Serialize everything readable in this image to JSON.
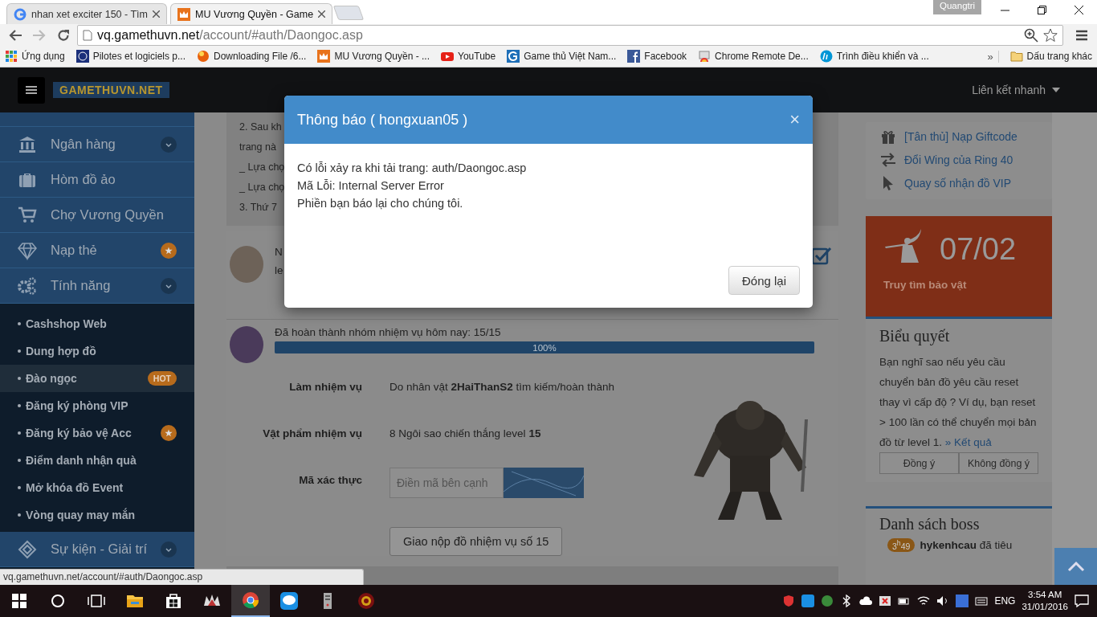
{
  "browser": {
    "tabs": [
      {
        "title": "nhan xet exciter 150 - Tìm",
        "kind": "google",
        "selected": false
      },
      {
        "title": "MU Vương Quyền - Game",
        "kind": "crown",
        "selected": true
      }
    ],
    "profile": "Quangtri",
    "address": {
      "host": "vq.gamethuvn.net",
      "path": "/account/#auth/Daongoc.asp"
    },
    "bookmarks": [
      {
        "label": "Ứng dụng",
        "kind": "apps"
      },
      {
        "label": "Pilotes et logiciels p...",
        "kind": "hp"
      },
      {
        "label": "Downloading File /6...",
        "kind": "ball"
      },
      {
        "label": "MU Vương Quyền - ...",
        "kind": "crown"
      },
      {
        "label": "YouTube",
        "kind": "youtube"
      },
      {
        "label": "Game thủ Việt Nam...",
        "kind": "g"
      },
      {
        "label": "Facebook",
        "kind": "facebook"
      },
      {
        "label": "Chrome Remote De...",
        "kind": "remote"
      },
      {
        "label": "Trình điều khiển và ...",
        "kind": "hp2"
      }
    ],
    "more": "»",
    "other_bookmarks": "Dấu trang khác",
    "status_url": "vq.gamethuvn.net/account/#auth/Daongoc.asp"
  },
  "header": {
    "logo": "GAMETHUVN.NET",
    "quick_links": "Liên kết nhanh"
  },
  "sidebar": {
    "items": [
      {
        "label": "Ngân hàng",
        "kind": "bank",
        "expandable": true,
        "starred": false
      },
      {
        "label": "Hòm đồ ảo",
        "kind": "suitcase",
        "expandable": false,
        "starred": false
      },
      {
        "label": "Chợ Vương Quyền",
        "kind": "cart",
        "expandable": false,
        "starred": false
      },
      {
        "label": "Nạp thẻ",
        "kind": "diamond",
        "expandable": false,
        "starred": true
      },
      {
        "label": "Tính năng",
        "kind": "gears",
        "expandable": true,
        "starred": false,
        "children": [
          {
            "label": "Cashshop Web",
            "starred": false,
            "selected": false
          },
          {
            "label": "Dung hợp đồ",
            "starred": false,
            "selected": false
          },
          {
            "label": "Đào ngọc",
            "starred": false,
            "badge": "HOT",
            "selected": true
          },
          {
            "label": "Đăng ký phòng VIP",
            "starred": false,
            "selected": false
          },
          {
            "label": "Đăng ký bảo vệ Acc",
            "starred": true,
            "selected": false
          },
          {
            "label": "Điểm danh nhận quà",
            "starred": false,
            "selected": false
          },
          {
            "label": "Mở khóa đồ Event",
            "starred": false,
            "selected": false
          },
          {
            "label": "Vòng quay may mắn",
            "starred": false,
            "selected": false
          }
        ]
      },
      {
        "label": "Sự kiện - Giải trí",
        "kind": "event",
        "expandable": true,
        "starred": false
      }
    ]
  },
  "notice": {
    "lines": [
      "2. Sau kh",
      "trang nà",
      "_ Lựa chọ",
      "_ Lựa chọ",
      "3. Thứ 7"
    ]
  },
  "quest_first": {
    "lines": [
      "N",
      "le"
    ],
    "checked": true
  },
  "quest_second": {
    "title": "Đã hoàn thành nhóm nhiệm vụ hôm nay: 15/15",
    "level": 1,
    "percent": "100%",
    "fields": [
      {
        "label": "Làm nhiệm vụ",
        "value": "Do nhân vật **2HaiThanS2** tìm kiếm/hoàn thành"
      },
      {
        "label": "Vật phẩm nhiệm vụ",
        "value": "8 Ngôi sao chiến thắng level **15**"
      }
    ],
    "code": {
      "label": "Mã xác thực",
      "placeholder": "Điền mã bên cạnh"
    },
    "submit": "Giao nộp đồ nhiệm vụ số 15"
  },
  "links": [
    {
      "label": "[Tân thủ] Nạp Giftcode",
      "kind": "gift"
    },
    {
      "label": "Đổi Wing của Ring 40",
      "kind": "swap"
    },
    {
      "label": "Quay số nhận đồ VIP",
      "kind": "pointer"
    }
  ],
  "event_tile": {
    "date": "07/02",
    "title": "Truy tìm bảo vật"
  },
  "poll": {
    "title": "Biểu quyết",
    "question": "Bạn nghĩ sao nếu yêu cầu chuyển bản đồ yêu cầu reset thay vì cấp độ ? Ví dụ, bạn reset > 100 lần có thể chuyển mọi bản đồ từ level 1.",
    "result_link": "» Kết quả",
    "buttons": [
      "Đồng ý",
      "Không đồng ý"
    ]
  },
  "boss_list": {
    "title": "Danh sách boss",
    "items": [
      {
        "time": "3$^{h}$49",
        "text": "**hykenhcau** đã tiêu"
      }
    ]
  },
  "modal": {
    "title": "Thông báo ( hongxuan05 )",
    "close": "×",
    "lines": [
      "Có lỗi xảy ra khi tải trang: auth/Daongoc.asp",
      "Mã Lỗi: Internal Server Error",
      "Phiền bạn báo lại cho chúng tôi."
    ],
    "button": "Đóng lại"
  },
  "taskbar": {
    "apps": [
      {
        "kind": "explorer",
        "selected": false
      },
      {
        "kind": "store",
        "selected": false
      },
      {
        "kind": "mu",
        "selected": false
      },
      {
        "kind": "chrome",
        "selected": true
      },
      {
        "kind": "zalo",
        "selected": false
      },
      {
        "kind": "server",
        "selected": false
      },
      {
        "kind": "game",
        "selected": false
      }
    ],
    "language": "ENG",
    "time": "3:54 AM",
    "date": "31/01/2016"
  }
}
